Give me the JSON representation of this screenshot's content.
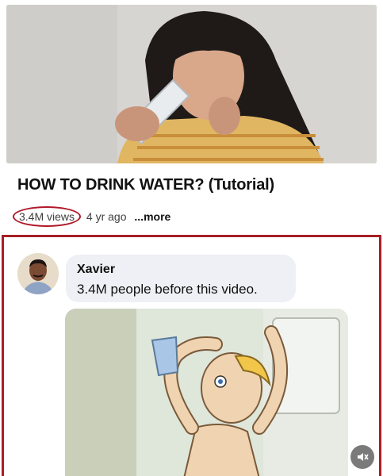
{
  "video": {
    "title": "HOW TO DRINK WATER? (Tutorial)",
    "views": "3.4M views",
    "age": "4 yr ago",
    "more_label": "...more"
  },
  "comment": {
    "author": "Xavier",
    "text": "3.4M people before this video."
  },
  "icons": {
    "avatar": "person-avatar",
    "mute": "speaker-muted-icon"
  },
  "colors": {
    "highlight_red": "#a61f26"
  }
}
